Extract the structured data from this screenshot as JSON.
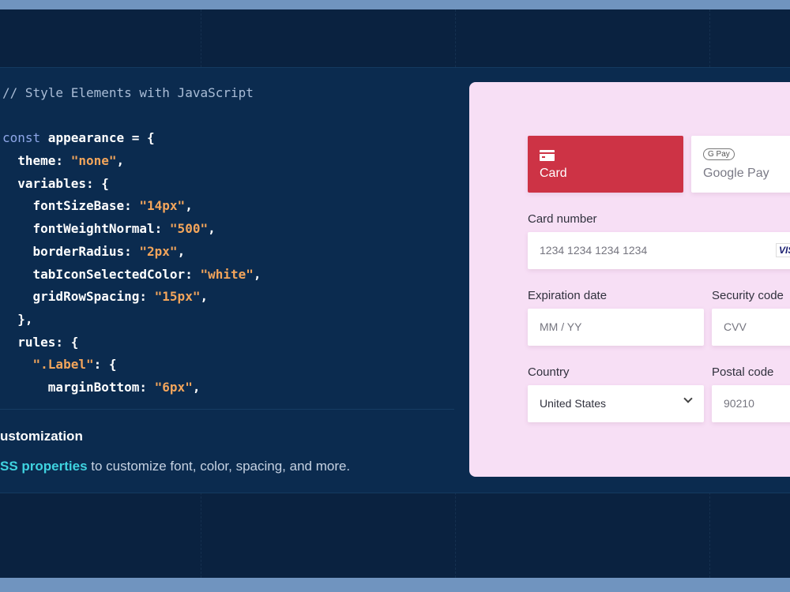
{
  "colors": {
    "accent": "#cd3345",
    "link": "#3fd3e0",
    "card_bg": "#f7dff5",
    "panel_bg": "#0b2b4f"
  },
  "code": {
    "lines": [
      [
        {
          "t": "// Style Elements with JavaScript",
          "c": "cm"
        }
      ],
      [],
      [
        {
          "t": "const",
          "c": "kw"
        },
        {
          "t": " appearance = {",
          "c": ""
        }
      ],
      [
        {
          "t": "  theme: ",
          "c": ""
        },
        {
          "t": "\"none\"",
          "c": "st"
        },
        {
          "t": ",",
          "c": ""
        }
      ],
      [
        {
          "t": "  variables: {",
          "c": ""
        }
      ],
      [
        {
          "t": "    fontSizeBase: ",
          "c": ""
        },
        {
          "t": "\"14px\"",
          "c": "st"
        },
        {
          "t": ",",
          "c": ""
        }
      ],
      [
        {
          "t": "    fontWeightNormal: ",
          "c": ""
        },
        {
          "t": "\"500\"",
          "c": "st"
        },
        {
          "t": ",",
          "c": ""
        }
      ],
      [
        {
          "t": "    borderRadius: ",
          "c": ""
        },
        {
          "t": "\"2px\"",
          "c": "st"
        },
        {
          "t": ",",
          "c": ""
        }
      ],
      [
        {
          "t": "    tabIconSelectedColor: ",
          "c": ""
        },
        {
          "t": "\"white\"",
          "c": "st"
        },
        {
          "t": ",",
          "c": ""
        }
      ],
      [
        {
          "t": "    gridRowSpacing: ",
          "c": ""
        },
        {
          "t": "\"15px\"",
          "c": "st"
        },
        {
          "t": ",",
          "c": ""
        }
      ],
      [
        {
          "t": "  },",
          "c": ""
        }
      ],
      [
        {
          "t": "  rules: {",
          "c": ""
        }
      ],
      [
        {
          "t": "    ",
          "c": ""
        },
        {
          "t": "\".Label\"",
          "c": "st"
        },
        {
          "t": ": {",
          "c": ""
        }
      ],
      [
        {
          "t": "      marginBottom: ",
          "c": ""
        },
        {
          "t": "\"6px\"",
          "c": "st"
        },
        {
          "t": ",",
          "c": ""
        }
      ]
    ]
  },
  "section": {
    "heading": "ustomization",
    "link": "SS properties",
    "text": " to customize font, color, spacing, and more."
  },
  "payment": {
    "tabs": [
      {
        "label": "Card",
        "icon": "credit-card-icon"
      },
      {
        "label": "Google Pay",
        "badge": "G Pay",
        "icon": "google-pay-icon"
      }
    ],
    "card_number": {
      "label": "Card number",
      "placeholder": "1234 1234 1234 1234",
      "brand": "VISA"
    },
    "expiration": {
      "label": "Expiration date",
      "placeholder": "MM / YY"
    },
    "security": {
      "label": "Security code",
      "placeholder": "CVV"
    },
    "country": {
      "label": "Country",
      "value": "United States"
    },
    "postal": {
      "label": "Postal code",
      "value": "90210"
    }
  }
}
